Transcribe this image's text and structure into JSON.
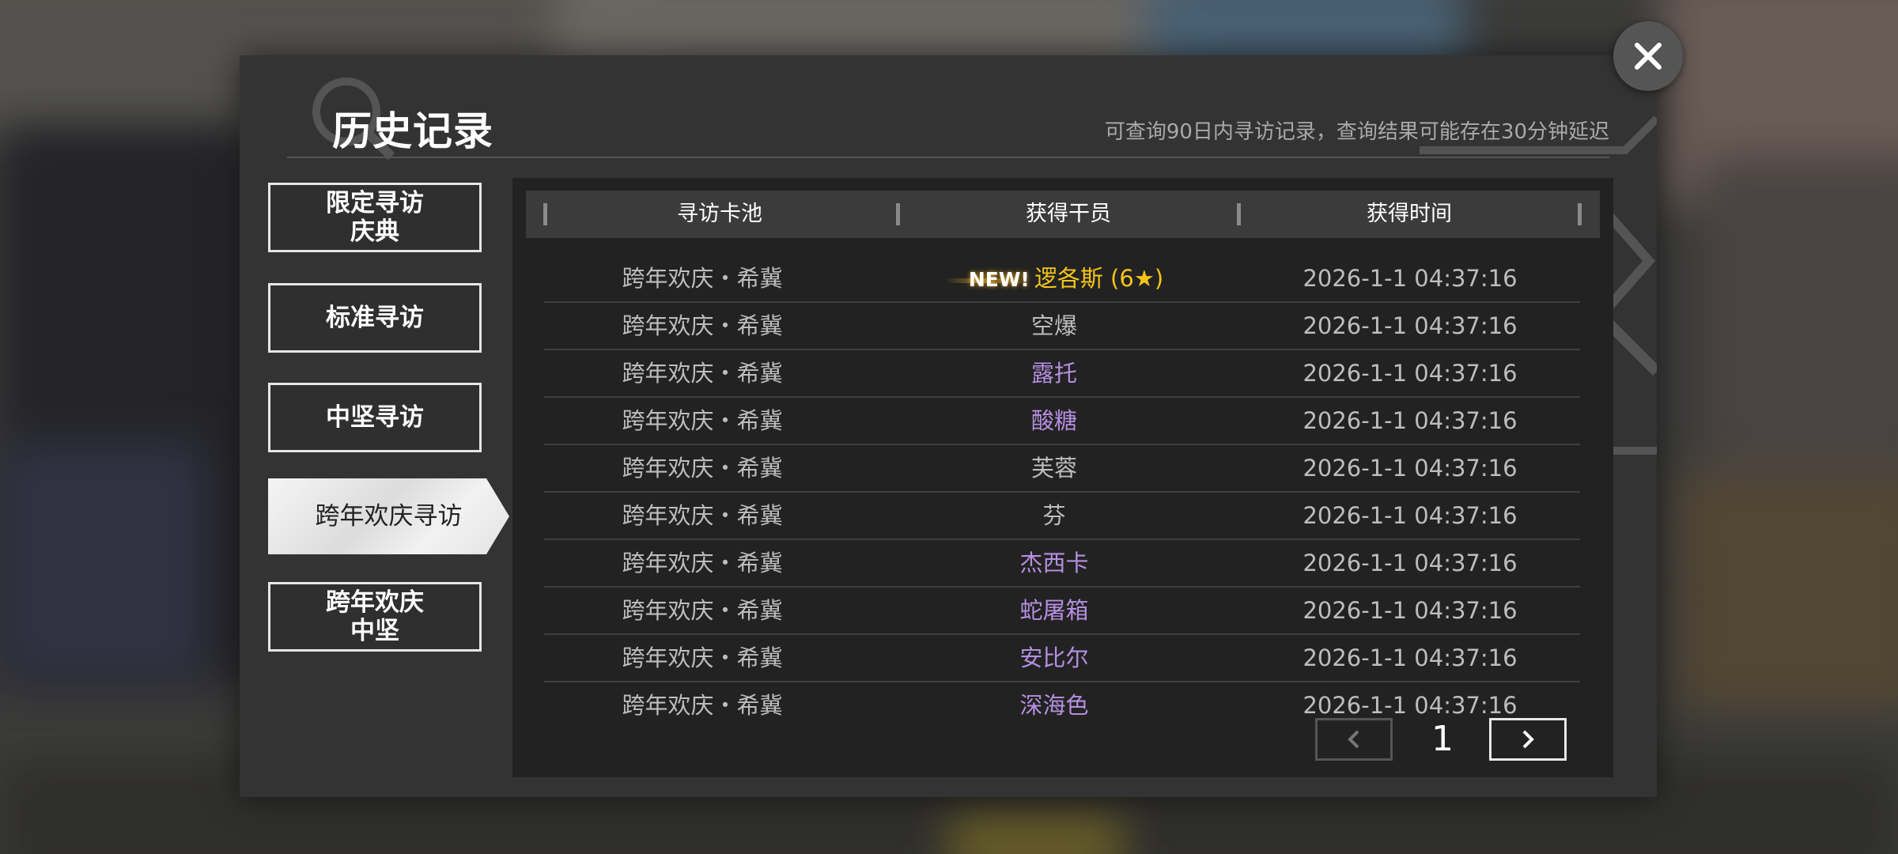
{
  "dialog": {
    "title": "历史记录",
    "hint": "可查询90日内寻访记录，查询结果可能存在30分钟延迟"
  },
  "tabs": [
    {
      "label": "限定寻访\n庆典",
      "active": false
    },
    {
      "label": "标准寻访",
      "active": false
    },
    {
      "label": "中坚寻访",
      "active": false
    },
    {
      "label": "跨年欢庆寻访",
      "active": true
    },
    {
      "label": "跨年欢庆\n中坚",
      "active": false
    }
  ],
  "table": {
    "headers": [
      "寻访卡池",
      "获得干员",
      "获得时间"
    ],
    "new_label": "NEW!",
    "rows": [
      {
        "pool": "跨年欢庆・希冀",
        "operator": "逻各斯 (6★)",
        "time": "2026-1-1 04:37:16",
        "rarity": "gold",
        "is_new": true
      },
      {
        "pool": "跨年欢庆・希冀",
        "operator": "空爆",
        "time": "2026-1-1 04:37:16",
        "rarity": "white",
        "is_new": false
      },
      {
        "pool": "跨年欢庆・希冀",
        "operator": "露托",
        "time": "2026-1-1 04:37:16",
        "rarity": "purple",
        "is_new": false
      },
      {
        "pool": "跨年欢庆・希冀",
        "operator": "酸糖",
        "time": "2026-1-1 04:37:16",
        "rarity": "purple",
        "is_new": false
      },
      {
        "pool": "跨年欢庆・希冀",
        "operator": "芙蓉",
        "time": "2026-1-1 04:37:16",
        "rarity": "white",
        "is_new": false
      },
      {
        "pool": "跨年欢庆・希冀",
        "operator": "芬",
        "time": "2026-1-1 04:37:16",
        "rarity": "white",
        "is_new": false
      },
      {
        "pool": "跨年欢庆・希冀",
        "operator": "杰西卡",
        "time": "2026-1-1 04:37:16",
        "rarity": "purple",
        "is_new": false
      },
      {
        "pool": "跨年欢庆・希冀",
        "operator": "蛇屠箱",
        "time": "2026-1-1 04:37:16",
        "rarity": "purple",
        "is_new": false
      },
      {
        "pool": "跨年欢庆・希冀",
        "operator": "安比尔",
        "time": "2026-1-1 04:37:16",
        "rarity": "purple",
        "is_new": false
      },
      {
        "pool": "跨年欢庆・希冀",
        "operator": "深海色",
        "time": "2026-1-1 04:37:16",
        "rarity": "purple",
        "is_new": false
      }
    ]
  },
  "pager": {
    "page": "1"
  },
  "icons": {
    "close": "close-icon",
    "prev": "chevron-left-icon",
    "next": "chevron-right-icon"
  },
  "colors": {
    "gold": "#f5c518",
    "purple": "#b58fe0",
    "white": "#bdbdbd"
  }
}
